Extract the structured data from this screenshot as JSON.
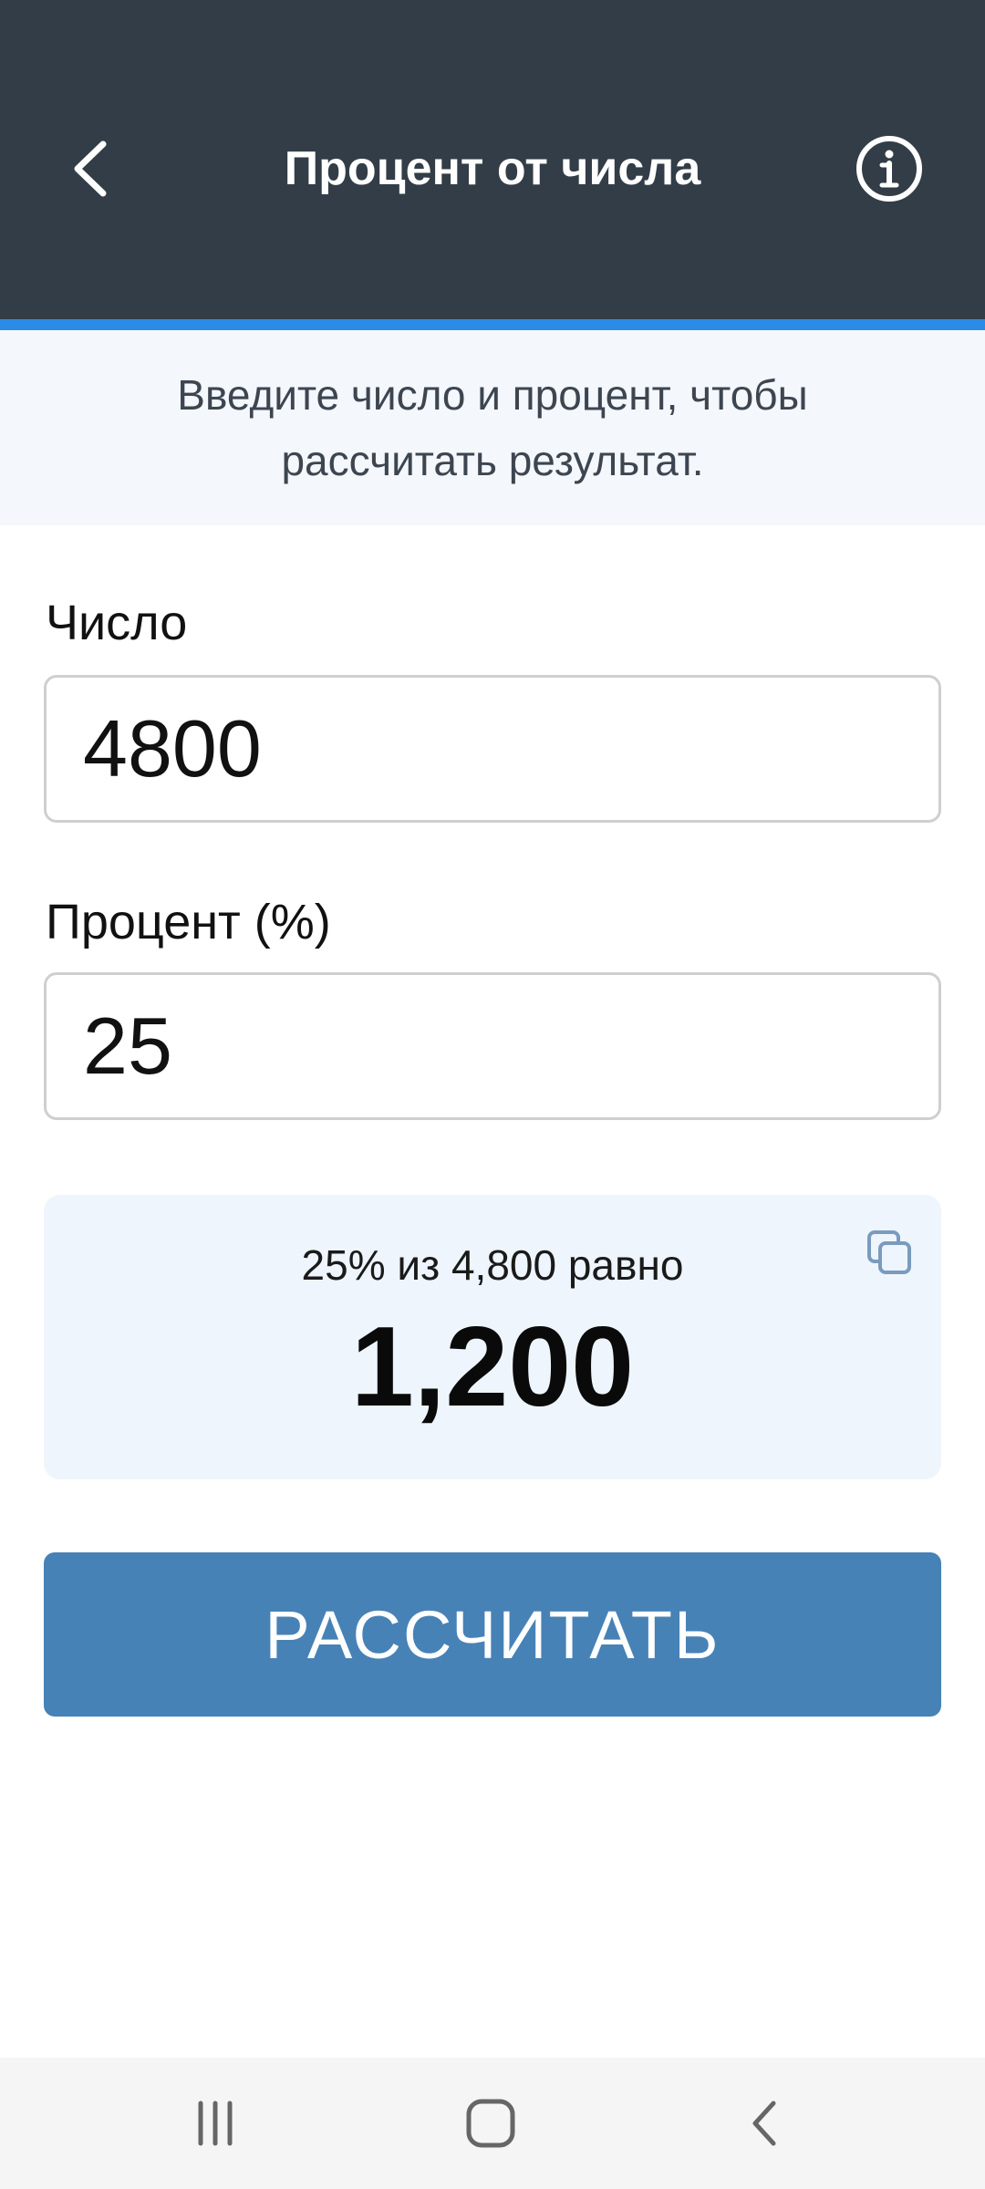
{
  "app_bar": {
    "title": "Процент от числа",
    "back_icon": "chevron-left-icon",
    "info_icon": "info-circle-icon",
    "background_color": "#323d47",
    "accent_color": "#2b8be6"
  },
  "hint": {
    "text": "Введите число и процент, чтобы рассчитать результат."
  },
  "form": {
    "number_label": "Число",
    "number_value": "4800",
    "percent_label": "Процент (%)",
    "percent_value": "25"
  },
  "result": {
    "caption": "25% из 4,800 равно",
    "value": "1,200",
    "copy_icon": "copy-icon",
    "background_color": "#eef5fd"
  },
  "action": {
    "calculate_label": "РАССЧИТАТЬ",
    "button_color": "#4782b6"
  },
  "system_nav": {
    "recents_icon": "recents-icon",
    "home_icon": "home-icon",
    "back_icon": "back-icon"
  }
}
